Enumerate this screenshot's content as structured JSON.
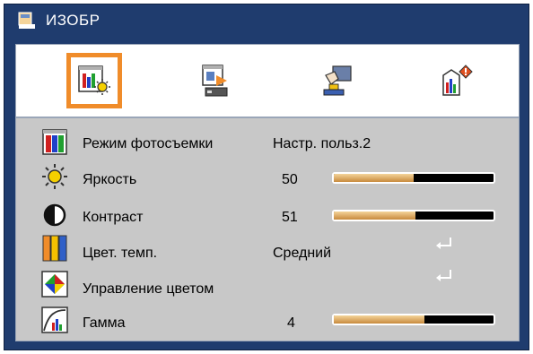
{
  "window": {
    "title": "ИЗОБР"
  },
  "tabs": [
    {
      "icon": "image-settings-icon",
      "selected": true
    },
    {
      "icon": "display-settings-icon",
      "selected": false
    },
    {
      "icon": "setup-icon",
      "selected": false
    },
    {
      "icon": "options-icon",
      "selected": false
    }
  ],
  "rows": [
    {
      "icon": "color-mode-icon",
      "label": "Режим фотосъемки",
      "value": "Настр. польз.2"
    },
    {
      "icon": "brightness-icon",
      "label": "Яркость",
      "value": "50",
      "level": 0.5
    },
    {
      "icon": "contrast-icon",
      "label": "Контраст",
      "value": "51",
      "level": 0.51
    },
    {
      "icon": "color-temp-icon",
      "label": "Цвет. темп.",
      "value": "Средний",
      "action_icon": "enter-icon"
    },
    {
      "icon": "color-management-icon",
      "label": "Управление цветом",
      "action_icon": "enter-icon"
    },
    {
      "icon": "gamma-icon",
      "label": "Гамма",
      "value": "4",
      "level": 0.57
    }
  ],
  "colors": {
    "frame": "#1f3c6e",
    "selection": "#f08c2a",
    "panel": "#c8c8c8",
    "slider_fill": "#d9a860"
  }
}
